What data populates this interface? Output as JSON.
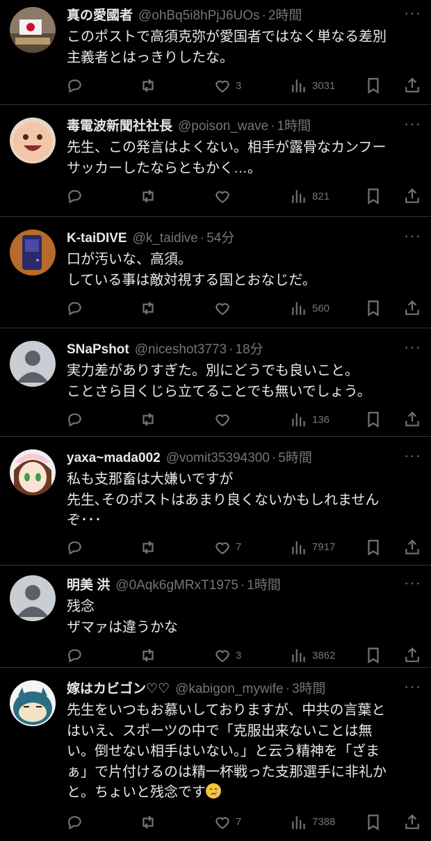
{
  "tweets": [
    {
      "name": "真の愛國者",
      "handle": "@ohBq5i8hPjJ6UOs",
      "time": "2時間",
      "text": "このポストで高須克弥が愛国者ではなく単なる差別\n主義者とはっきりしたな。",
      "likes": "3",
      "views": "3031",
      "avatar": "flag"
    },
    {
      "name": "毒電波新聞社社長",
      "handle": "@poison_wave",
      "time": "1時間",
      "text": "先生、この発言はよくない。相手が露骨なカンフー\nサッカーしたならともかく…。",
      "likes": "",
      "views": "821",
      "avatar": "baby"
    },
    {
      "name": "K-taiDIVE",
      "handle": "@k_taidive",
      "time": "54分",
      "text": "口が汚いな、高須。\nしている事は敵対視する国とおなじだ。",
      "likes": "",
      "views": "560",
      "avatar": "phone"
    },
    {
      "name": "SNaPshot",
      "handle": "@niceshot3773",
      "time": "18分",
      "text": "実力差がありすぎた。別にどうでも良いこと。\nことさら目くじら立てることでも無いでしょう。",
      "likes": "",
      "views": "136",
      "avatar": "default"
    },
    {
      "name": "yaxa~mada002",
      "handle": "@vomit35394300",
      "time": "5時間",
      "text": "私も支那畜は大嫌いですが\n先生､そのポストはあまり良くないかもしれません\nぞ･･･",
      "likes": "7",
      "views": "7917",
      "avatar": "anime"
    },
    {
      "name": "明美 洪",
      "handle": "@0Aqk6gMRxT1975",
      "time": "1時間",
      "text": "残念\nザマァは違うかな",
      "likes": "3",
      "views": "3862",
      "avatar": "default"
    },
    {
      "name": "嫁はカビゴン♡♡",
      "handle": "@kabigon_mywife",
      "time": "3時間",
      "text": "先生をいつもお慕いしておりますが、中共の言葉と\nはいえ、スポーツの中で「克服出来ないことは無\nい。倒せない相手はいない。」と云う精神を「ざま\nぁ」で片付けるのは精一杯戦った支那選手に非礼か\nと。ちょいと残念です",
      "likes": "7",
      "views": "7388",
      "avatar": "snorlax",
      "emoji": "crying-face"
    }
  ]
}
